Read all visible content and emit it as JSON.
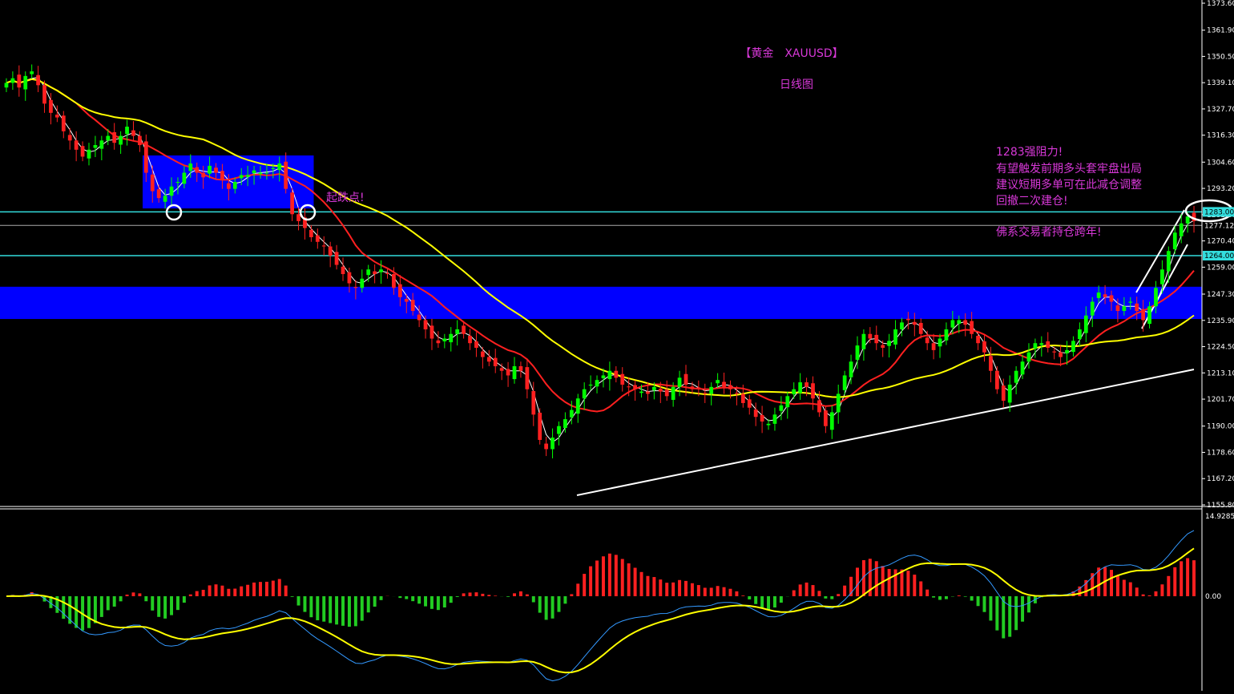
{
  "chart_title": "【黄金　XAUUSD】",
  "chart_subtitle": "日线图",
  "annotations": {
    "start_fall": "起跌点!",
    "note_lines": [
      "1283强阻力!",
      "有望触发前期多头套牢盘出局",
      "建议短期多单可在此减仓调整",
      "回撤二次建仓!",
      "",
      "佛系交易者持仓跨年!"
    ]
  },
  "colors": {
    "background": "#000000",
    "bull_candle": "#00ff00",
    "bear_candle": "#ff2020",
    "ma_fast": "#ffffff",
    "ma_mid": "#ff2020",
    "ma_slow": "#ffff00",
    "zone": "#0000ff",
    "level_line": "#33dddd",
    "annotation": "#d838d8",
    "macd_pos": "#ff2020",
    "macd_neg": "#22cc22",
    "macd_line": "#3399ff",
    "signal_line": "#ffff00"
  },
  "chart_data": {
    "type": "candlestick",
    "title": "【黄金　XAUUSD】",
    "subtitle": "日线图",
    "y_axis": {
      "ticks": [
        1373.6,
        1361.9,
        1350.5,
        1339.1,
        1327.7,
        1316.3,
        1304.6,
        1293.2,
        1281.8,
        1270.4,
        1259.0,
        1247.3,
        1235.9,
        1224.5,
        1213.1,
        1201.7,
        1190.0,
        1178.6,
        1167.2,
        1155.8
      ],
      "tick_labels": [
        "1373.60",
        "1361.90",
        "1350.50",
        "1339.10",
        "1327.70",
        "1316.30",
        "1304.60",
        "1293.20",
        "1281.80",
        "1270.40",
        "1259.00",
        "1247.30",
        "1235.90",
        "1224.50",
        "1213.10",
        "1201.70",
        "1190.00",
        "1178.60",
        "1167.20",
        "1155.80"
      ],
      "range": [
        1155.8,
        1376.5
      ]
    },
    "price_labels": [
      {
        "value": 1283.0,
        "text": "1283.00"
      },
      {
        "value": 1277.12,
        "text": "1277.12"
      },
      {
        "value": 1264.0,
        "text": "1264.00"
      }
    ],
    "horizontal_levels": [
      1283.0,
      1264.0,
      1277.12
    ],
    "zones": [
      {
        "y_from": 1284.5,
        "y_to": 1307.5,
        "x_from_bar": 0.2,
        "x_to_bar": 0.255
      },
      {
        "y_from": 1236.5,
        "y_to": 1250.5,
        "x_from_bar": 0.0,
        "x_to_bar": 1.0
      }
    ],
    "closes": [
      1339,
      1341,
      1337,
      1342,
      1344,
      1338,
      1330,
      1326,
      1324,
      1318,
      1314,
      1310,
      1307,
      1310,
      1312,
      1314,
      1316,
      1313,
      1316,
      1320,
      1316,
      1312,
      1300,
      1292,
      1289,
      1290,
      1294,
      1296,
      1300,
      1304,
      1300,
      1298,
      1303,
      1300,
      1297,
      1293,
      1296,
      1299,
      1299,
      1301,
      1300,
      1300,
      1302,
      1304,
      1293,
      1282,
      1279,
      1276,
      1272,
      1270,
      1268,
      1264,
      1260,
      1256,
      1252,
      1250,
      1254,
      1258,
      1256,
      1258,
      1256,
      1250,
      1246,
      1244,
      1240,
      1236,
      1232,
      1228,
      1226,
      1228,
      1230,
      1232,
      1230,
      1226,
      1224,
      1220,
      1218,
      1216,
      1214,
      1212,
      1216,
      1214,
      1206,
      1195,
      1184,
      1180,
      1185,
      1190,
      1193,
      1197,
      1202,
      1206,
      1208,
      1210,
      1212,
      1214,
      1211,
      1208,
      1207,
      1206,
      1205,
      1204,
      1207,
      1205,
      1203,
      1207,
      1211,
      1208,
      1206,
      1206,
      1204,
      1207,
      1210,
      1207,
      1206,
      1204,
      1200,
      1198,
      1194,
      1192,
      1191,
      1195,
      1199,
      1203,
      1206,
      1209,
      1207,
      1202,
      1196,
      1190,
      1196,
      1204,
      1212,
      1218,
      1225,
      1230,
      1228,
      1226,
      1224,
      1227,
      1232,
      1235,
      1236,
      1234,
      1230,
      1226,
      1223,
      1228,
      1232,
      1236,
      1236,
      1234,
      1230,
      1226,
      1222,
      1214,
      1206,
      1201,
      1208,
      1214,
      1218,
      1222,
      1226,
      1226,
      1224,
      1222,
      1220,
      1223,
      1227,
      1232,
      1238,
      1244,
      1248,
      1246,
      1244,
      1240,
      1242,
      1244,
      1240,
      1236,
      1242,
      1250,
      1258,
      1266,
      1274,
      1278,
      1281,
      1279
    ],
    "macd": {
      "zero_value": 0.0,
      "top_value": 14.9285,
      "tick_labels": [
        "14.9285",
        "0.00"
      ]
    }
  }
}
